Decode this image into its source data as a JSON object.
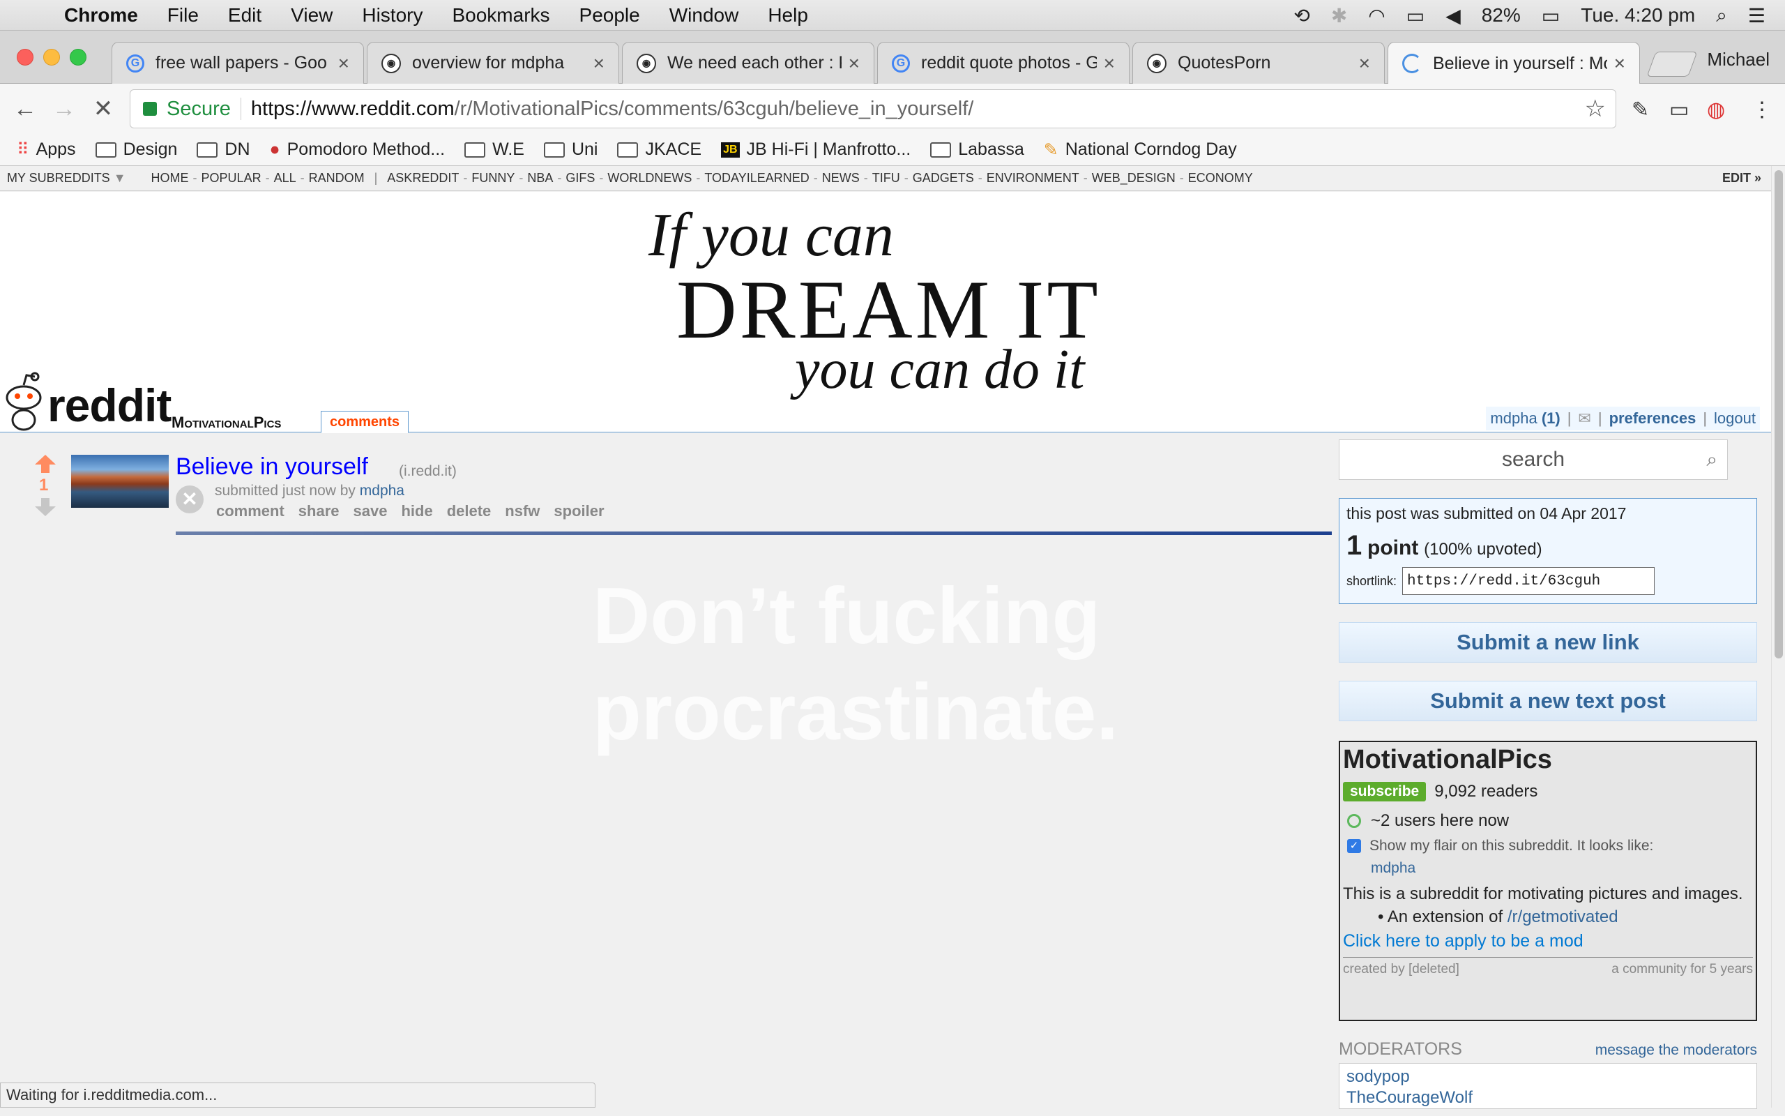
{
  "menubar": {
    "app": "Chrome",
    "items": [
      "File",
      "Edit",
      "View",
      "History",
      "Bookmarks",
      "People",
      "Window",
      "Help"
    ],
    "battery": "82%",
    "clock": "Tue. 4:20 pm"
  },
  "tabs": [
    {
      "title": "free wall papers - Goo",
      "favicon": "google-icon"
    },
    {
      "title": "overview for mdpha",
      "favicon": "reddit-icon"
    },
    {
      "title": "We need each other : P",
      "favicon": "reddit-icon"
    },
    {
      "title": "reddit quote photos - G",
      "favicon": "google-icon"
    },
    {
      "title": "QuotesPorn",
      "favicon": "reddit-icon"
    },
    {
      "title": "Believe in yourself : Mo",
      "favicon": "loading-icon"
    }
  ],
  "profile": "Michael",
  "omnibox": {
    "secure_label": "Secure",
    "url_host": "https://www.reddit.com",
    "url_path": "/r/MotivationalPics/comments/63cguh/believe_in_yourself/"
  },
  "bookmarks": [
    "Apps",
    "Design",
    "DN",
    "Pomodoro Method...",
    "W.E",
    "Uni",
    "JKACE",
    "JB Hi-Fi | Manfrotto...",
    "Labassa",
    "National Corndog Day"
  ],
  "srbar": {
    "my_subreddits": "MY SUBREDDITS",
    "links": [
      "HOME",
      "POPULAR",
      "ALL",
      "RANDOM"
    ],
    "subs": [
      "ASKREDDIT",
      "FUNNY",
      "NBA",
      "GIFS",
      "WORLDNEWS",
      "TODAYILEARNED",
      "NEWS",
      "TIFU",
      "GADGETS",
      "ENVIRONMENT",
      "WEB_DESIGN",
      "ECONOMY"
    ],
    "edit": "EDIT »"
  },
  "header": {
    "banner_l1": "If you can",
    "banner_l2": "DREAM IT",
    "banner_l3": "you can do it",
    "wordmark": "reddit",
    "subreddit": "MotivationalPics",
    "tab": "comments",
    "user": "mdpha",
    "karma": "(1)",
    "preferences": "preferences",
    "logout": "logout"
  },
  "post": {
    "score": "1",
    "title": "Believe in yourself",
    "domain": "(i.redd.it)",
    "tagline_prefix": "submitted just now by",
    "author": "mdpha",
    "buttons": [
      "comment",
      "share",
      "save",
      "hide",
      "delete",
      "nsfw",
      "spoiler"
    ],
    "image_text_l1": "Don’t fucking",
    "image_text_l2": "procrastinate."
  },
  "sidebar": {
    "search_placeholder": "search",
    "submitted": "this post was submitted on 04 Apr 2017",
    "points": "1",
    "points_word": "point",
    "upvoted": "(100% upvoted)",
    "shortlink_label": "shortlink:",
    "shortlink": "https://redd.it/63cguh",
    "submit_link": "Submit a new link",
    "submit_text": "Submit a new text post",
    "sr_title": "MotivationalPics",
    "subscribe": "subscribe",
    "readers": "9,092 readers",
    "online": "~2 users here now",
    "flair_text": "Show my flair on this subreddit. It looks like:",
    "flair_name": "mdpha",
    "description": "This is a subreddit for motivating pictures and images.",
    "bullet_prefix": "An extension of",
    "bullet_link": "/r/getmotivated",
    "apply_mod": "Click here to apply to be a mod",
    "created_by": "created by [deleted]",
    "community_age": "a community for 5 years",
    "moderators_title": "MODERATORS",
    "message_mods": "message the moderators",
    "mods": [
      "sodypop",
      "TheCourageWolf"
    ]
  },
  "status": "Waiting for i.redditmedia.com...",
  "colors": {
    "reddit_blue": "#336699",
    "orange": "#ff4500",
    "upvote": "#ff8b60",
    "secure_green": "#1e8e3e"
  }
}
